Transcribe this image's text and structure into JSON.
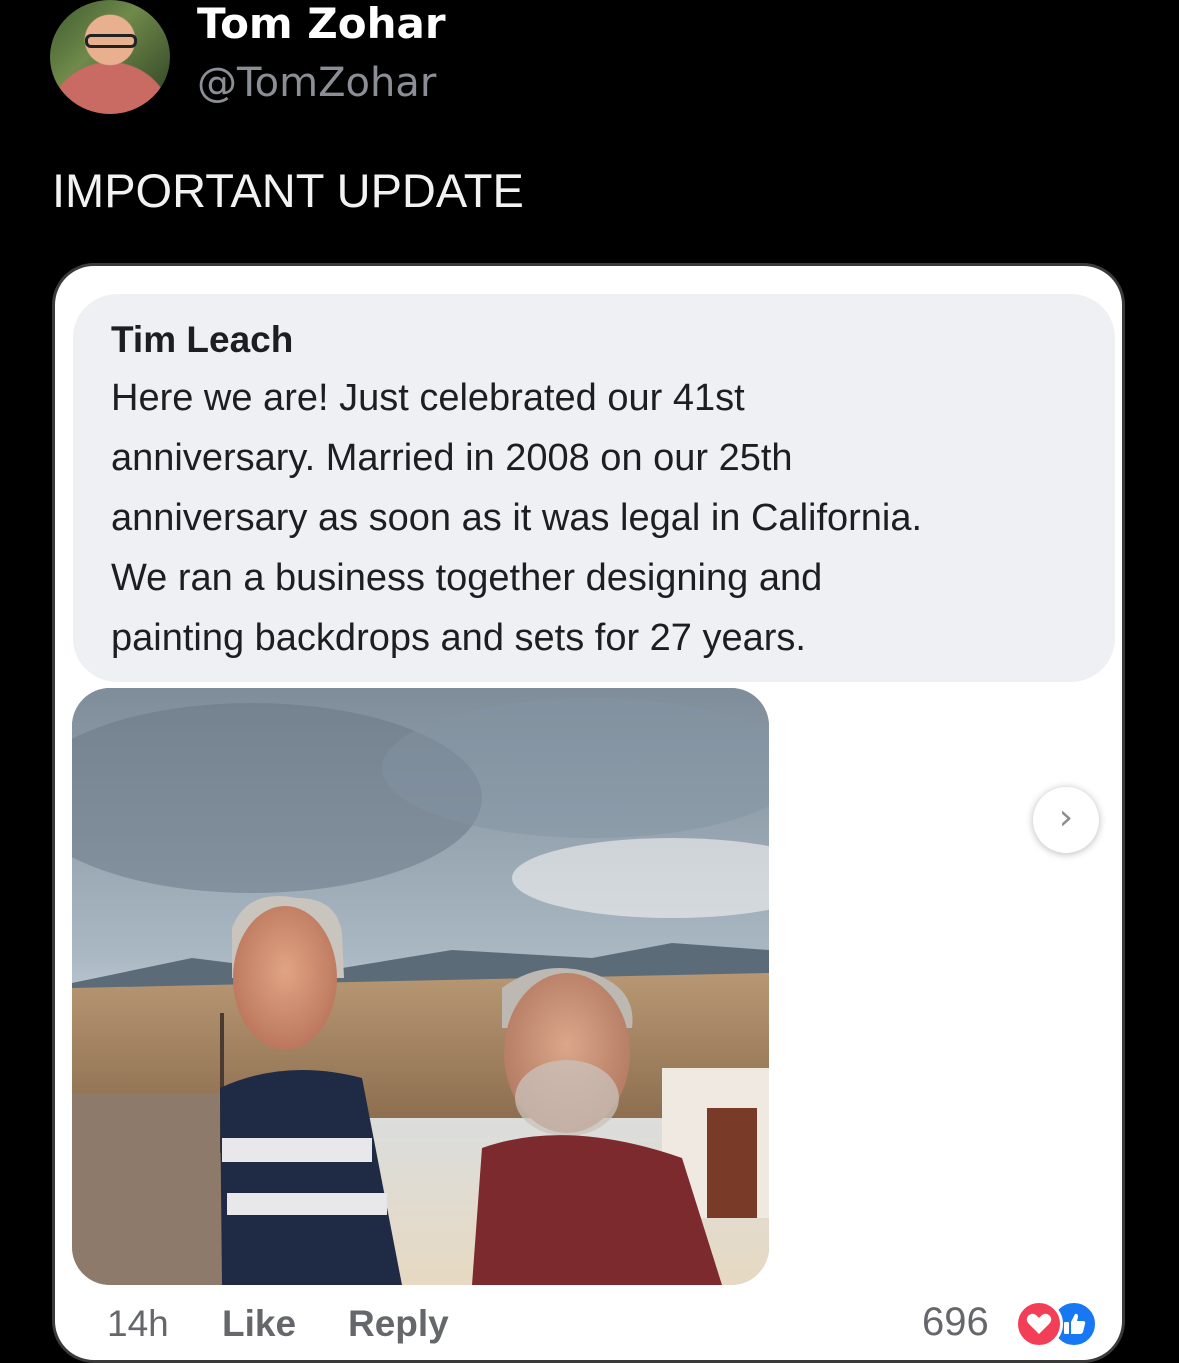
{
  "tweet": {
    "author_name": "Tom Zohar",
    "author_handle": "@TomZohar",
    "text": "IMPORTANT UPDATE"
  },
  "embedded_comment": {
    "commenter_name": "Tim Leach",
    "text_lines": [
      "Here we are! Just celebrated our 41st",
      "anniversary. Married in 2008 on our 25th",
      "anniversary as soon as it was legal in California.",
      "We ran a business together designing and",
      "painting backdrops and sets for 27 years."
    ],
    "photo_icon": "photo",
    "next_icon": "chevron-right-icon",
    "next_glyph": "›",
    "time": "14h",
    "like_label": "Like",
    "reply_label": "Reply",
    "reaction_count": "696",
    "reactions": [
      "love-reaction-icon",
      "like-reaction-icon"
    ]
  },
  "colors": {
    "background": "#000000",
    "handle": "#8b8f95",
    "bubble": "#eef0f3",
    "meta_text": "#65676b",
    "love": "#f33e58",
    "like": "#1877f2"
  }
}
